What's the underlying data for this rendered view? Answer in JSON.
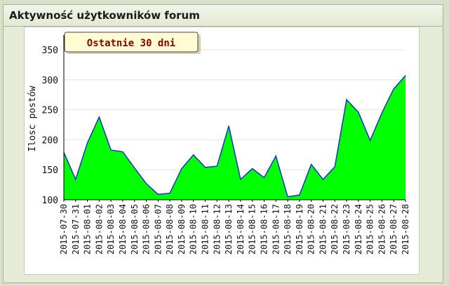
{
  "window": {
    "title": "Aktywność użytkowników forum"
  },
  "chart_data": {
    "type": "area",
    "title": "Ostatnie 30 dni",
    "xlabel": "",
    "ylabel": "Ilosc postów",
    "ylim": [
      100,
      370
    ],
    "yticks": [
      100,
      150,
      200,
      250,
      300,
      350
    ],
    "grid": true,
    "fill_color": "#00ff00",
    "line_color": "#1a2fd6",
    "x": [
      "2015-07-30",
      "2015-07-31",
      "2015-08-01",
      "2015-08-02",
      "2015-08-03",
      "2015-08-04",
      "2015-08-05",
      "2015-08-06",
      "2015-08-07",
      "2015-08-08",
      "2015-08-09",
      "2015-08-10",
      "2015-08-11",
      "2015-08-12",
      "2015-08-13",
      "2015-08-14",
      "2015-08-15",
      "2015-08-16",
      "2015-08-17",
      "2015-08-18",
      "2015-08-19",
      "2015-08-20",
      "2015-08-21",
      "2015-08-22",
      "2015-08-23",
      "2015-08-24",
      "2015-08-25",
      "2015-08-26",
      "2015-08-27",
      "2015-08-28"
    ],
    "series": [
      {
        "values": [
          179,
          134,
          195,
          238,
          183,
          180,
          153,
          127,
          109,
          111,
          152,
          175,
          154,
          156,
          223,
          134,
          152,
          137,
          173,
          105,
          108,
          159,
          134,
          155,
          267,
          246,
          199,
          245,
          285,
          307
        ]
      }
    ]
  }
}
